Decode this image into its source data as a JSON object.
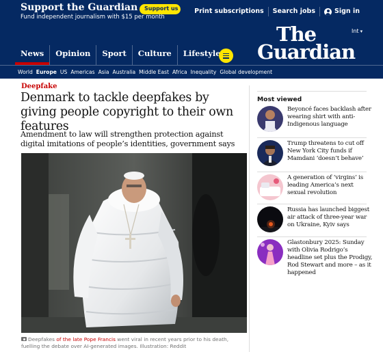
{
  "support": {
    "title": "Support the Guardian",
    "subtitle": "Fund independent journalism with $15 per month",
    "button_label": "Support us",
    "button_arrow": "→"
  },
  "top_links": {
    "print": "Print subscriptions",
    "jobs": "Search jobs",
    "signin": "Sign in"
  },
  "masthead": {
    "edition": "Int",
    "logo_line1": "The",
    "logo_line2": "Guardian"
  },
  "pillars": [
    "News",
    "Opinion",
    "Sport",
    "Culture",
    "Lifestyle"
  ],
  "subnav": [
    "World",
    "Europe",
    "US",
    "Americas",
    "Asia",
    "Australia",
    "Middle East",
    "Africa",
    "Inequality",
    "Global development"
  ],
  "article": {
    "kicker": "Deepfake",
    "headline": "Denmark to tackle deepfakes by giving people copyright to their own features",
    "standfirst": "Amendment to law will strengthen protection against digital imitations of people’s identities, government says",
    "caption_prefix": "Deepfakes ",
    "caption_link": "of the late Pope Francis",
    "caption_rest": " went viral in recent years prior to his death, fuelling the debate over AI-generated images. Illustration: Reddit"
  },
  "most_viewed": {
    "title": "Most viewed",
    "items": [
      {
        "headline": "Beyoncé faces backlash after wearing shirt with anti-Indigenous language",
        "thumb": "beyonce-thumb"
      },
      {
        "headline": "Trump threatens to cut off New York City funds if Mamdani ‘doesn’t behave’",
        "thumb": "trump-mamdani-thumb"
      },
      {
        "headline": "A generation of ‘virgins’ is leading America’s next sexual revolution",
        "thumb": "bed-thumb"
      },
      {
        "headline": "Russia has launched biggest air attack of three-year war on Ukraine, Kyiv says",
        "thumb": "night-sky-thumb"
      },
      {
        "headline": "Glastonbury 2025: Sunday with Olivia Rodrigo’s headline set plus the Prodigy, Rod Stewart and more – as it happened",
        "thumb": "concert-thumb"
      }
    ]
  },
  "colors": {
    "brand_blue": "#052962",
    "news_red": "#c70000",
    "support_yellow": "#ffe500"
  }
}
